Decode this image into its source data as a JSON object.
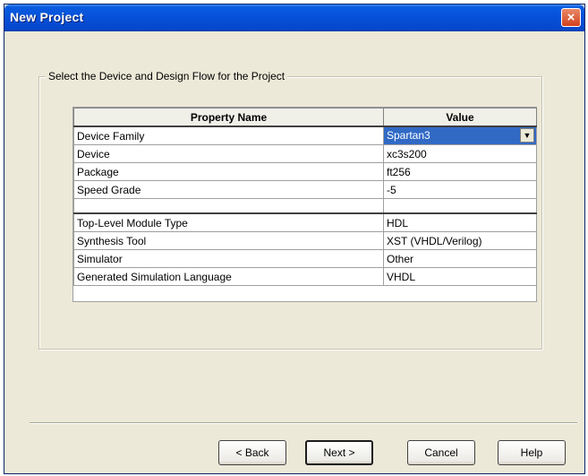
{
  "window": {
    "title": "New Project",
    "close_glyph": "×"
  },
  "group": {
    "label": "Select the Device and Design Flow for the Project"
  },
  "table": {
    "headers": [
      "Property Name",
      "Value"
    ],
    "rows": [
      {
        "name": "Device Family",
        "value": "Spartan3"
      },
      {
        "name": "Device",
        "value": "xc3s200"
      },
      {
        "name": "Package",
        "value": "ft256"
      },
      {
        "name": "Speed Grade",
        "value": "-5"
      },
      {
        "name": "",
        "value": ""
      },
      {
        "name": "Top-Level Module Type",
        "value": "HDL"
      },
      {
        "name": "Synthesis Tool",
        "value": "XST (VHDL/Verilog)"
      },
      {
        "name": "Simulator",
        "value": "Other"
      },
      {
        "name": "Generated Simulation Language",
        "value": "VHDL"
      }
    ]
  },
  "buttons": {
    "back": "< Back",
    "next": "Next >",
    "cancel": "Cancel",
    "help": "Help"
  },
  "icons": {
    "close": "close-icon",
    "dropdown": "chevron-down-icon"
  },
  "colors": {
    "titlebar": "#0650D8",
    "dialog_bg": "#ECE9D8",
    "selection": "#316AC5",
    "close_button": "#D2401C"
  }
}
